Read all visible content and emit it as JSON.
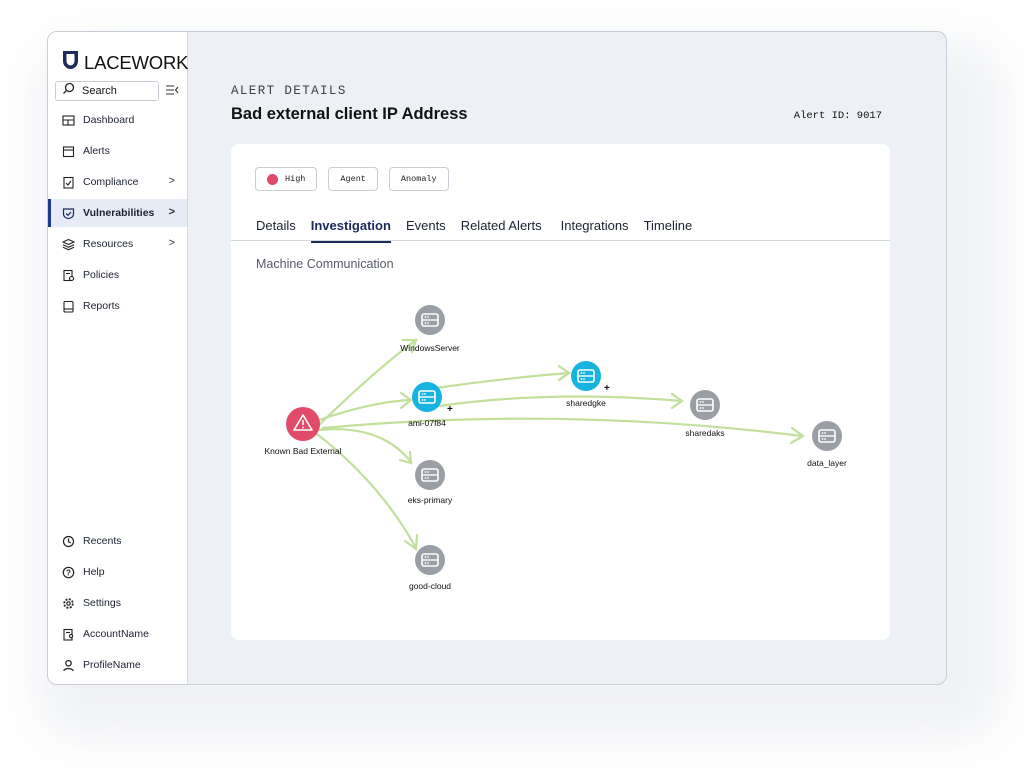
{
  "brand": {
    "name": "LACEWORK",
    "color": "#1c2a5c"
  },
  "search": {
    "label": "Search"
  },
  "nav": {
    "top": [
      {
        "label": "Dashboard",
        "icon": "dashboard-icon"
      },
      {
        "label": "Alerts",
        "icon": "alerts-icon"
      },
      {
        "label": "Compliance",
        "icon": "compliance-icon",
        "chevron": ">"
      },
      {
        "label": "Vulnerabilities",
        "icon": "vulnerabilities-icon",
        "chevron": ">",
        "active": true
      },
      {
        "label": "Resources",
        "icon": "resources-icon",
        "chevron": ">"
      },
      {
        "label": "Policies",
        "icon": "policies-icon"
      },
      {
        "label": "Reports",
        "icon": "reports-icon"
      }
    ],
    "bottom": [
      {
        "label": "Recents",
        "icon": "recents-icon"
      },
      {
        "label": "Help",
        "icon": "help-icon"
      },
      {
        "label": "Settings",
        "icon": "settings-icon"
      },
      {
        "label": "AccountName",
        "icon": "account-icon"
      },
      {
        "label": "ProfileName",
        "icon": "profile-icon"
      }
    ]
  },
  "header": {
    "crumb": "ALERT DETAILS",
    "title": "Bad external client IP Address",
    "alert_id": "Alert ID: 9017"
  },
  "badges": {
    "severity": "High",
    "type": "Agent",
    "kind": "Anomaly",
    "severity_color": "#e24a6a"
  },
  "tabs": [
    "Details",
    "Investigation",
    "Events",
    "Related Alerts",
    "Integrations",
    "Timeline"
  ],
  "active_tab": "Investigation",
  "section_title": "Machine Communication",
  "graph": {
    "nodes": {
      "source": "Known Bad External",
      "windows": "WindowsServer",
      "ami": "ami-07f84",
      "sharedgke": "sharedgke",
      "sharedaks": "sharedaks",
      "data_layer": "data_layer",
      "eks": "eks-primary",
      "good_cloud": "good-cloud"
    },
    "colors": {
      "source": "#e24a6a",
      "active": "#18b4e0",
      "inactive": "#9a9ea5",
      "edge": "#c2df9c"
    }
  }
}
